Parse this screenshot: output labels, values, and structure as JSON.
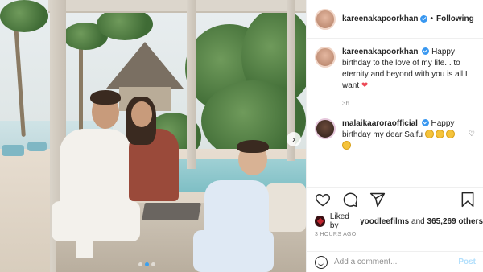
{
  "header": {
    "username": "kareenakapoorkhan",
    "separator": "•",
    "follow_status": "Following"
  },
  "caption": {
    "username": "kareenakapoorkhan",
    "text": "Happy birthday to the love of my life... to eternity and beyond with you is all I want",
    "emoji": "heart",
    "age": "3h"
  },
  "reply": {
    "username": "malaikaaroraofficial",
    "text": "Happy birthday my dear Saifu",
    "emoji_count": 4
  },
  "likes": {
    "prefix": "Liked by",
    "user": "yoodleefilms",
    "connector": "and",
    "count": "365,269",
    "suffix": "others"
  },
  "timestamp": "3 HOURS AGO",
  "add_comment": {
    "placeholder": "Add a comment...",
    "post_label": "Post"
  },
  "photo": {
    "carousel_index": 2,
    "carousel_total": 3
  },
  "icons": {
    "like": "heart-icon",
    "comment": "comment-icon",
    "share": "share-icon",
    "save": "bookmark-icon",
    "next": "chevron-right-icon",
    "emoji": "smiley-icon"
  },
  "colors": {
    "verified": "#3897f0",
    "post_disabled": "#b2dffc",
    "active_dot": "#3aa0f0",
    "heart_red": "#ed4956"
  }
}
